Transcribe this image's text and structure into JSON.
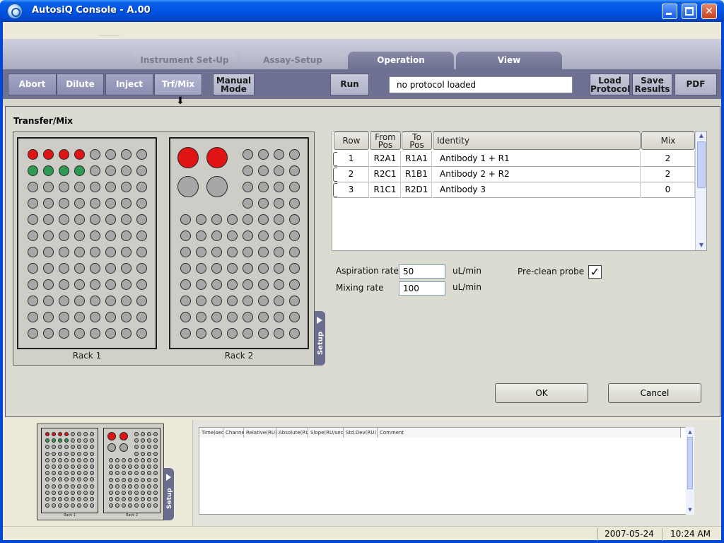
{
  "window": {
    "title": "AutosiQ Console - A.00"
  },
  "tabs": [
    {
      "label": "Instrument Set-Up"
    },
    {
      "label": "Assay-Setup"
    },
    {
      "label": "Operation"
    },
    {
      "label": "View"
    }
  ],
  "toolbar": {
    "abort": "Abort",
    "dilute": "Dilute",
    "inject": "Inject",
    "trfmix": "Trf/Mix",
    "manual_mode_1": "Manual",
    "manual_mode_2": "Mode",
    "run": "Run",
    "protocol_status": "no protocol loaded",
    "load_protocol_1": "Load",
    "load_protocol_2": "Protocol",
    "save_results_1": "Save",
    "save_results_2": "Results",
    "pdf": "PDF"
  },
  "dialog": {
    "title": "Transfer/Mix",
    "rack1_label": "Rack 1",
    "rack2_label": "Rack 2",
    "setup_tab": "Setup",
    "grid": {
      "headers": {
        "row": "Row",
        "from_pos_1": "From",
        "from_pos_2": "Pos",
        "to_pos_1": "To",
        "to_pos_2": "Pos",
        "identity": "Identity",
        "mix": "Mix"
      },
      "rows": [
        {
          "row": "1",
          "from": "R2A1",
          "to": "R1A1",
          "identity": "Antibody 1 + R1",
          "mix": "2"
        },
        {
          "row": "2",
          "from": "R2C1",
          "to": "R1B1",
          "identity": "Antibody 2 + R2",
          "mix": "2"
        },
        {
          "row": "3",
          "from": "R1C1",
          "to": "R2D1",
          "identity": "Antibody 3",
          "mix": "0"
        }
      ]
    },
    "aspiration_rate_label": "Aspiration rate",
    "aspiration_rate_value": "50",
    "aspiration_unit": "uL/min",
    "mixing_rate_label": "Mixing rate",
    "mixing_rate_value": "100",
    "mixing_unit": "uL/min",
    "preclean_label": "Pre-clean probe",
    "preclean_checked": "✓",
    "ok": "OK",
    "cancel": "Cancel"
  },
  "mini_panel": {
    "rack1_label": "Rack 1",
    "rack2_label": "Rack 2",
    "setup_tab": "Setup"
  },
  "log": {
    "columns": [
      "Time(sec)",
      "Channel",
      "Relative(RU)",
      "Absolute(RU)",
      "Slope(RU/sec)",
      "Std.Dev(RU)",
      "Comment"
    ]
  },
  "statusbar": {
    "date": "2007-05-24",
    "time": "10:24 AM"
  },
  "colors": {
    "well_red": "#e01414",
    "well_green": "#2f9a52",
    "well_grey": "#a7a7a7",
    "tab_active": "#6e7091"
  },
  "rack1_wells": {
    "red": [
      "A1",
      "A2",
      "A3",
      "A4"
    ],
    "green": [
      "B1",
      "B2",
      "B3",
      "B4"
    ]
  },
  "rack2_large_wells": {
    "red": [
      "A1",
      "B1"
    ],
    "grey": [
      "C1",
      "D1"
    ]
  }
}
